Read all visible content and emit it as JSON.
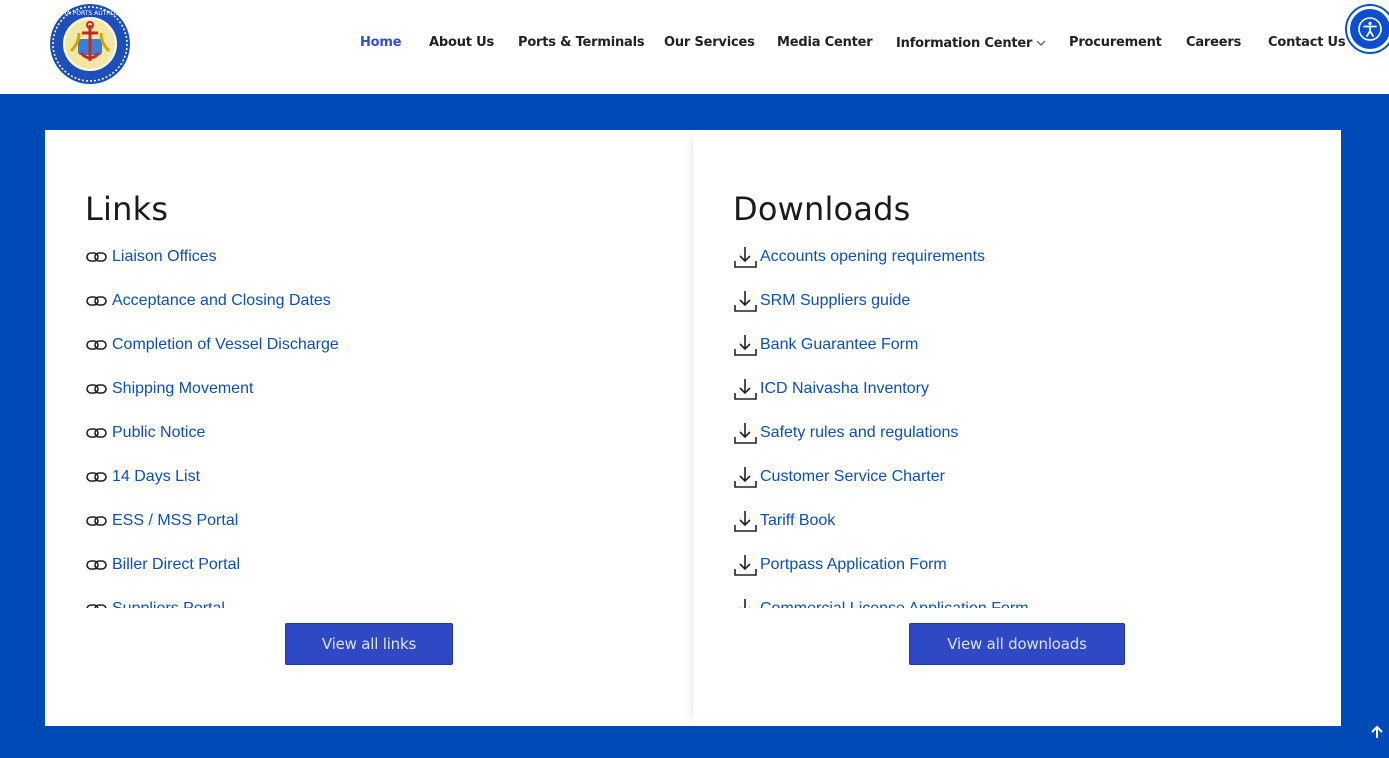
{
  "header": {
    "logo_text": "KENYA PORTS AUTHORITY",
    "nav": [
      {
        "label": "Home",
        "active": true
      },
      {
        "label": "About Us"
      },
      {
        "label": "Ports & Terminals"
      },
      {
        "label": "Our Services"
      },
      {
        "label": "Media Center"
      },
      {
        "label": "Information Center",
        "has_dropdown": true
      },
      {
        "label": "Procurement"
      },
      {
        "label": "Careers"
      },
      {
        "label": "Contact Us"
      }
    ],
    "accessibility_icon": "accessibility-icon"
  },
  "links": {
    "title": "Links",
    "icon": "link-icon",
    "items": [
      "Liaison Offices",
      "Acceptance and Closing Dates",
      "Completion of Vessel Discharge",
      "Shipping Movement",
      "Public Notice",
      "14 Days List",
      "ESS / MSS Portal",
      "Biller Direct Portal",
      "Suppliers Portal"
    ],
    "button_label": "View all links"
  },
  "downloads": {
    "title": "Downloads",
    "icon": "download-icon",
    "items": [
      "Accounts opening requirements",
      "SRM Suppliers guide",
      "Bank Guarantee Form",
      "ICD Naivasha Inventory",
      "Safety rules and regulations",
      "Customer Service Charter",
      "Tariff Book",
      "Portpass Application Form",
      "Commercial License Application Form"
    ],
    "button_label": "View all downloads"
  },
  "colors": {
    "background_blue": "#004ab8",
    "link_blue": "#0d4fb5",
    "button_blue": "#2f48c4",
    "active_nav": "#2f4fc4"
  },
  "scroll_top_icon": "arrow-up-icon"
}
